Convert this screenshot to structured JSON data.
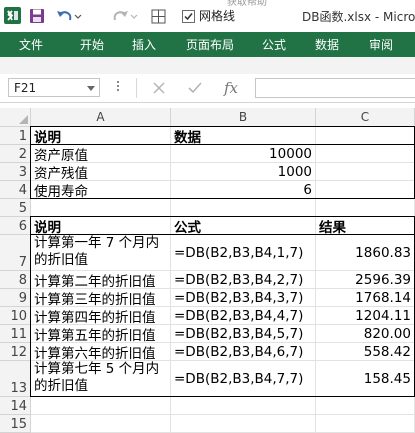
{
  "titlebar": {
    "ghost_text": "获取帮助",
    "gridlines_label": "网格线",
    "gridlines_checked": true,
    "doc_title": "DB函数.xlsx - Micro",
    "accent_color": "#217346"
  },
  "ribbon": {
    "file_label": "文件",
    "tabs": [
      "开始",
      "插入",
      "页面布局",
      "公式",
      "数据",
      "审阅"
    ]
  },
  "formula_bar": {
    "name_box": "F21",
    "formula": "",
    "fx_label": "fx"
  },
  "sheet": {
    "columns": [
      "A",
      "B",
      "C"
    ],
    "rows": [
      "1",
      "2",
      "3",
      "4",
      "5",
      "6",
      "7",
      "8",
      "9",
      "10",
      "11",
      "12",
      "13",
      "14",
      "15"
    ],
    "cells": {
      "A1": "说明",
      "B1": "数据",
      "A2": "资产原值",
      "B2": "10000",
      "A3": "资产残值",
      "B3": "1000",
      "A4": "使用寿命",
      "B4": "6",
      "A6": "说明",
      "B6": "公式",
      "C6": "结果",
      "A7": "计算第一年 7 个月内的折旧值",
      "B7": "=DB(B2,B3,B4,1,7)",
      "C7": "1860.83",
      "A8": "计算第二年的折旧值",
      "B8": "=DB(B2,B3,B4,2,7)",
      "C8": "2596.39",
      "A9": "计算第三年的折旧值",
      "B9": "=DB(B2,B3,B4,3,7)",
      "C9": "1768.14",
      "A10": "计算第四年的折旧值",
      "B10": "=DB(B2,B3,B4,4,7)",
      "C10": "1204.11",
      "A11": "计算第五年的折旧值",
      "B11": "=DB(B2,B3,B4,5,7)",
      "C11": "820.00",
      "A12": "计算第六年的折旧值",
      "B12": "=DB(B2,B3,B4,6,7)",
      "C12": "558.42",
      "A13": "计算第七年 5 个月内的折旧值",
      "B13": "=DB(B2,B3,B4,7,7)",
      "C13": "158.45"
    }
  }
}
